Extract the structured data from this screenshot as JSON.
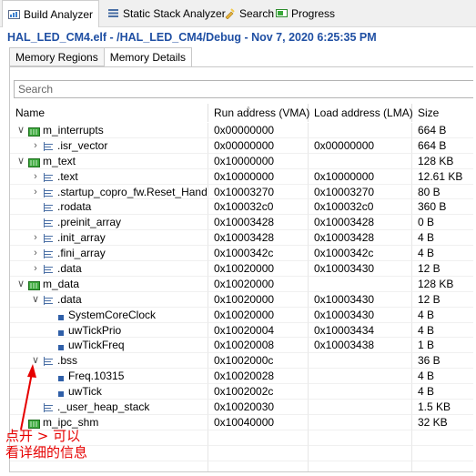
{
  "view_tabs": [
    {
      "label": "Build Analyzer",
      "icon": "build-analyzer-icon"
    },
    {
      "label": "Static Stack Analyzer",
      "icon": "stack-analyzer-icon"
    },
    {
      "label": "Search",
      "icon": "search-flashlight-icon"
    },
    {
      "label": "Progress",
      "icon": "progress-icon"
    }
  ],
  "heading": "HAL_LED_CM4.elf - /HAL_LED_CM4/Debug - Nov 7, 2020 6:25:35 PM",
  "sub_tabs": [
    "Memory Regions",
    "Memory Details"
  ],
  "search": {
    "placeholder": "Search"
  },
  "columns": {
    "name": "Name",
    "vma": "Run address (VMA)",
    "lma": "Load address (LMA)",
    "size": "Size"
  },
  "rows": [
    {
      "level": 0,
      "toggle": "open",
      "icon": "region",
      "name": "m_interrupts",
      "vma": "0x00000000",
      "lma": "",
      "size": "664 B"
    },
    {
      "level": 1,
      "toggle": "closed",
      "icon": "section",
      "name": ".isr_vector",
      "vma": "0x00000000",
      "lma": "0x00000000",
      "size": "664 B"
    },
    {
      "level": 0,
      "toggle": "open",
      "icon": "region",
      "name": "m_text",
      "vma": "0x10000000",
      "lma": "",
      "size": "128 KB"
    },
    {
      "level": 1,
      "toggle": "closed",
      "icon": "section",
      "name": ".text",
      "vma": "0x10000000",
      "lma": "0x10000000",
      "size": "12.61 KB"
    },
    {
      "level": 1,
      "toggle": "closed",
      "icon": "section",
      "name": ".startup_copro_fw.Reset_Handler",
      "vma": "0x10003270",
      "lma": "0x10003270",
      "size": "80 B"
    },
    {
      "level": 1,
      "toggle": "none",
      "icon": "section",
      "name": ".rodata",
      "vma": "0x100032c0",
      "lma": "0x100032c0",
      "size": "360 B"
    },
    {
      "level": 1,
      "toggle": "none",
      "icon": "section",
      "name": ".preinit_array",
      "vma": "0x10003428",
      "lma": "0x10003428",
      "size": "0 B"
    },
    {
      "level": 1,
      "toggle": "closed",
      "icon": "section",
      "name": ".init_array",
      "vma": "0x10003428",
      "lma": "0x10003428",
      "size": "4 B"
    },
    {
      "level": 1,
      "toggle": "closed",
      "icon": "section",
      "name": ".fini_array",
      "vma": "0x1000342c",
      "lma": "0x1000342c",
      "size": "4 B"
    },
    {
      "level": 1,
      "toggle": "closed",
      "icon": "section",
      "name": ".data",
      "vma": "0x10020000",
      "lma": "0x10003430",
      "size": "12 B"
    },
    {
      "level": 0,
      "toggle": "open",
      "icon": "region",
      "name": "m_data",
      "vma": "0x10020000",
      "lma": "",
      "size": "128 KB"
    },
    {
      "level": 1,
      "toggle": "open",
      "icon": "section",
      "name": ".data",
      "vma": "0x10020000",
      "lma": "0x10003430",
      "size": "12 B"
    },
    {
      "level": 2,
      "toggle": "none",
      "icon": "symbol",
      "name": "SystemCoreClock",
      "vma": "0x10020000",
      "lma": "0x10003430",
      "size": "4 B"
    },
    {
      "level": 2,
      "toggle": "none",
      "icon": "symbol",
      "name": "uwTickPrio",
      "vma": "0x10020004",
      "lma": "0x10003434",
      "size": "4 B"
    },
    {
      "level": 2,
      "toggle": "none",
      "icon": "symbol",
      "name": "uwTickFreq",
      "vma": "0x10020008",
      "lma": "0x10003438",
      "size": "1 B"
    },
    {
      "level": 1,
      "toggle": "open",
      "icon": "section",
      "name": ".bss",
      "vma": "0x1002000c",
      "lma": "",
      "size": "36 B"
    },
    {
      "level": 2,
      "toggle": "none",
      "icon": "symbol",
      "name": "Freq.10315",
      "vma": "0x10020028",
      "lma": "",
      "size": "4 B"
    },
    {
      "level": 2,
      "toggle": "none",
      "icon": "symbol",
      "name": "uwTick",
      "vma": "0x1002002c",
      "lma": "",
      "size": "4 B"
    },
    {
      "level": 1,
      "toggle": "none",
      "icon": "section",
      "name": "._user_heap_stack",
      "vma": "0x10020030",
      "lma": "",
      "size": "1.5 KB"
    },
    {
      "level": 0,
      "toggle": "none",
      "icon": "region",
      "name": "m_ipc_shm",
      "vma": "0x10040000",
      "lma": "",
      "size": "32 KB"
    }
  ],
  "annotation": {
    "line1": "点开 > 可以",
    "line2": "看详细的信息",
    "color": "#e60000"
  },
  "colors": {
    "heading": "#1f4fa3",
    "region_icon": "#2e8b2e",
    "section_icon": "#4a6fa5",
    "symbol_icon": "#2f5fa8"
  }
}
